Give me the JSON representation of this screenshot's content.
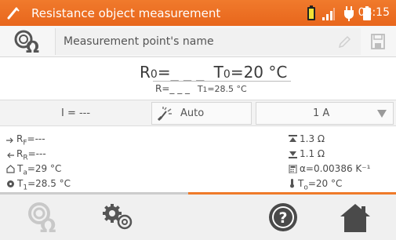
{
  "header": {
    "title": "Resistance object measurement",
    "time": "08:15",
    "icons": [
      "probe-icon",
      "battery-full-icon",
      "signal-icon",
      "plug-icon",
      "battery-icon"
    ],
    "accent_color": "#ef7a2a"
  },
  "name_row": {
    "placeholder": "Measurement point's name",
    "icons": [
      "resistance-icon",
      "pencil-icon",
      "save-icon"
    ]
  },
  "result": {
    "r0_label": "R",
    "r0_sub": "0",
    "r0_value": "=_ _ _",
    "t0_label": "T",
    "t0_sub": "0",
    "t0_value": "=20 °C",
    "r_label": "R=_ _ _",
    "t1_label": "T",
    "t1_sub": "1",
    "t1_value": "=28.5 °C"
  },
  "controls": {
    "current": "I = ---",
    "auto_label": "Auto",
    "range_value": "1 A"
  },
  "params": {
    "rf_label": "R",
    "rf_sub": "F",
    "rf_value": "=---",
    "rr_label": "R",
    "rr_sub": "R",
    "rr_value": "=---",
    "ta_label": "T",
    "ta_sub": "a",
    "ta_value": "=29 °C",
    "t1_label": "T",
    "t1_sub": "1",
    "t1_value": "=28.5 °C",
    "upper_limit": "1.3 Ω",
    "lower_limit": "1.1 Ω",
    "alpha": "α=0.00386 K⁻¹",
    "t0_label": "T",
    "t0_sub": "o",
    "t0_value": "=20 °C"
  },
  "progress": {
    "segments": [
      "grey",
      "orange"
    ]
  },
  "toolbar": {
    "icons": [
      "resistance-mode-icon",
      "settings-icon",
      "help-icon",
      "home-icon"
    ]
  }
}
